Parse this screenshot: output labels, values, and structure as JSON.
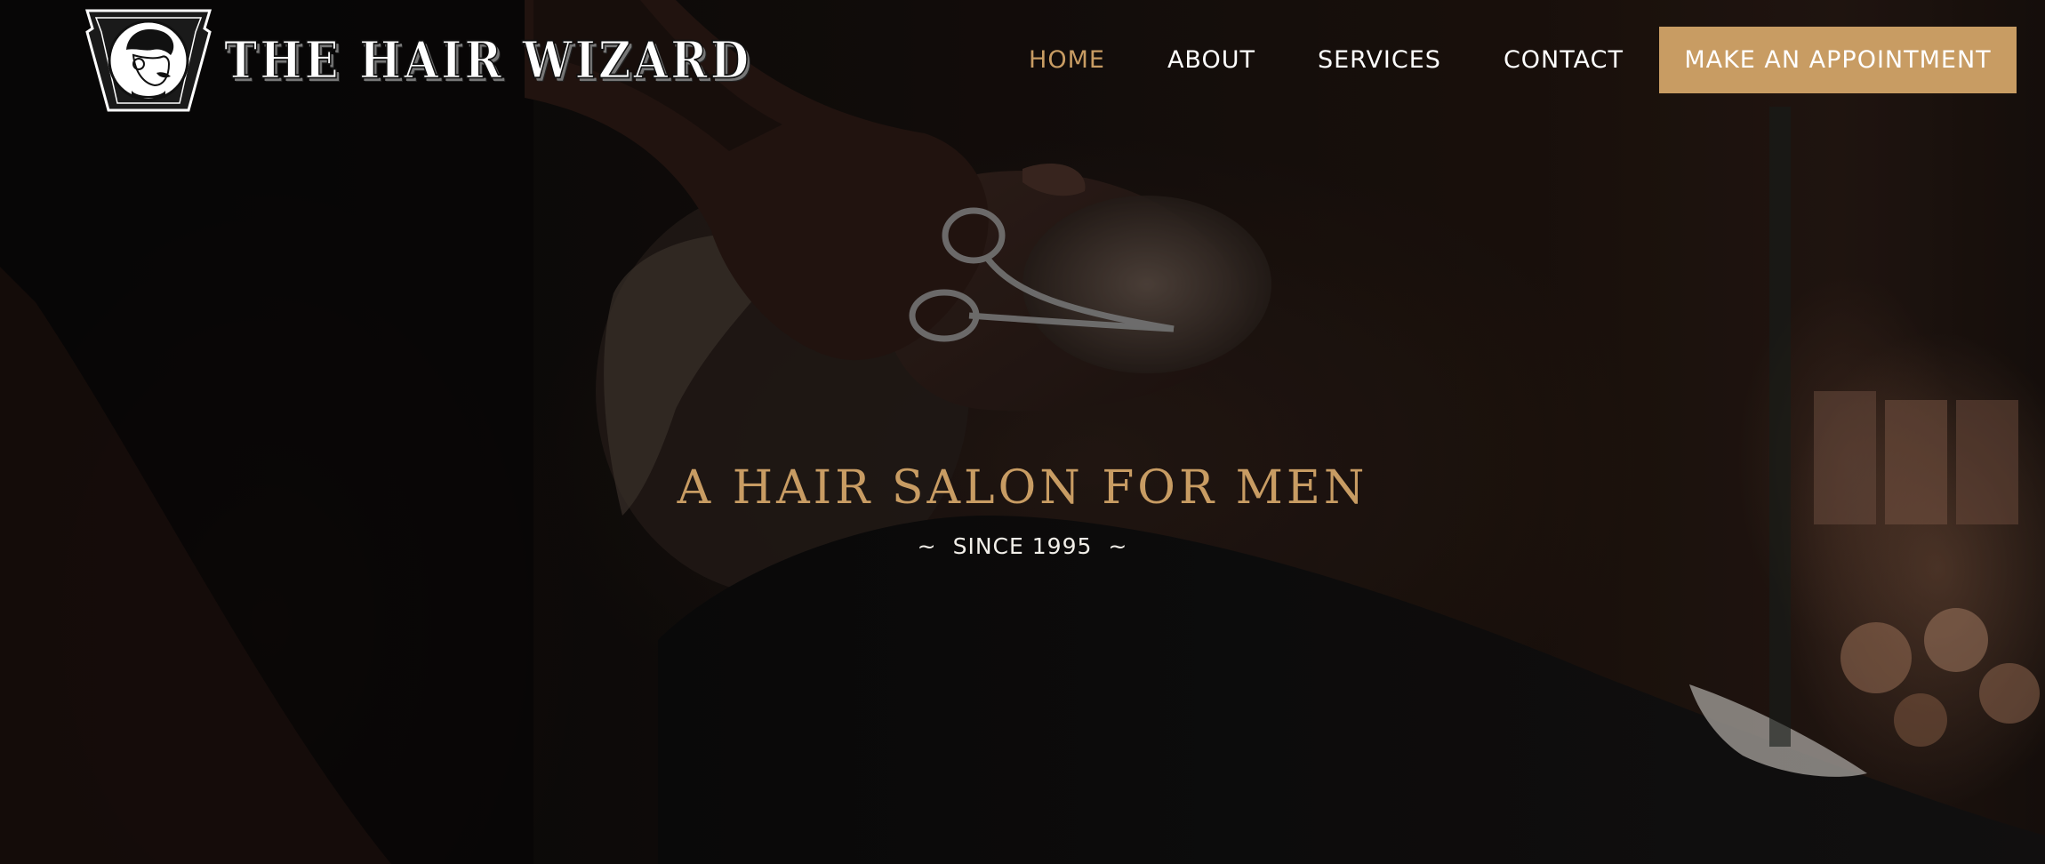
{
  "brand": {
    "name": "THE HAIR WIZARD"
  },
  "nav": {
    "items": [
      {
        "label": "HOME"
      },
      {
        "label": "ABOUT"
      },
      {
        "label": "SERVICES"
      },
      {
        "label": "CONTACT"
      }
    ],
    "cta_label": "MAKE AN APPOINTMENT"
  },
  "hero": {
    "headline": "A HAIR SALON FOR MEN",
    "tagline": "SINCE 1995",
    "tilde": "~"
  },
  "colors": {
    "accent": "#c89c63",
    "nav_text": "#ffffff",
    "background": "#0b0908"
  },
  "icons": {
    "logo_badge": "barber-portrait-keystone-icon"
  }
}
